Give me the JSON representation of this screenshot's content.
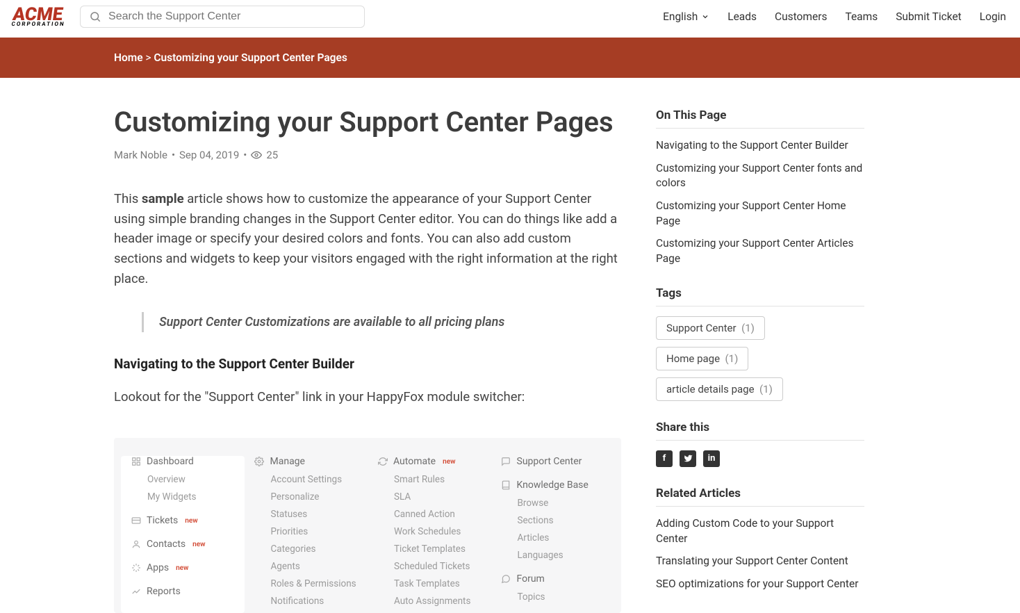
{
  "header": {
    "logo_top": "ACME",
    "logo_sub": "CORPORATION",
    "search_placeholder": "Search the Support Center",
    "language": "English",
    "nav": [
      "Leads",
      "Customers",
      "Teams",
      "Submit Ticket",
      "Login"
    ]
  },
  "breadcrumb": {
    "home": "Home",
    "sep": ">",
    "current": "Customizing your Support Center Pages"
  },
  "article": {
    "title": "Customizing your Support Center Pages",
    "author": "Mark Noble",
    "date": "Sep 04, 2019",
    "views": "25",
    "intro_pre": "This ",
    "intro_bold": "sample",
    "intro_post": " article shows how to customize the appearance of your Support Center using simple branding changes in the Support Center editor. You can do things like add a header image or specify your desired colors and fonts.  You can also add custom sections and widgets to keep your visitors engaged with the right information at the right place.",
    "callout": "Support Center Customizations are available to all pricing plans",
    "h2": "Navigating to the Support Center Builder",
    "p2": "Lookout for the \"Support Center\" link in your HappyFox module switcher:"
  },
  "module_switcher": {
    "col1": {
      "dashboard": "Dashboard",
      "dashboard_items": [
        "Overview",
        "My Widgets"
      ],
      "tickets": "Tickets",
      "contacts": "Contacts",
      "apps": "Apps",
      "reports": "Reports"
    },
    "col2": {
      "manage": "Manage",
      "items": [
        "Account Settings",
        "Personalize",
        "Statuses",
        "Priorities",
        "Categories",
        "Agents",
        "Roles & Permissions",
        "Notifications"
      ]
    },
    "col3": {
      "automate": "Automate",
      "items": [
        "Smart Rules",
        "SLA",
        "Canned Action",
        "Work Schedules",
        "Ticket Templates",
        "Scheduled Tickets",
        "Task Templates",
        "Auto Assignments"
      ]
    },
    "col4": {
      "sc": "Support Center",
      "kb": "Knowledge Base",
      "kb_items": [
        "Browse",
        "Sections",
        "Articles",
        "Languages"
      ],
      "forum": "Forum",
      "forum_items": [
        "Topics"
      ]
    },
    "new_label": "new"
  },
  "sidebar": {
    "on_this_page": "On This Page",
    "toc": [
      "Navigating to the Support Center Builder",
      "Customizing your Support Center fonts and colors",
      "Customizing your Support Center Home Page",
      "Customizing your Support Center Articles Page"
    ],
    "tags_title": "Tags",
    "tags": [
      {
        "label": "Support Center",
        "count": "(1)"
      },
      {
        "label": "Home page",
        "count": "(1)"
      },
      {
        "label": "article details page",
        "count": "(1)"
      }
    ],
    "share_title": "Share this",
    "related_title": "Related Articles",
    "related": [
      "Adding Custom Code to your Support Center",
      "Translating your Support Center Content",
      "SEO optimizations for your Support Center"
    ]
  }
}
